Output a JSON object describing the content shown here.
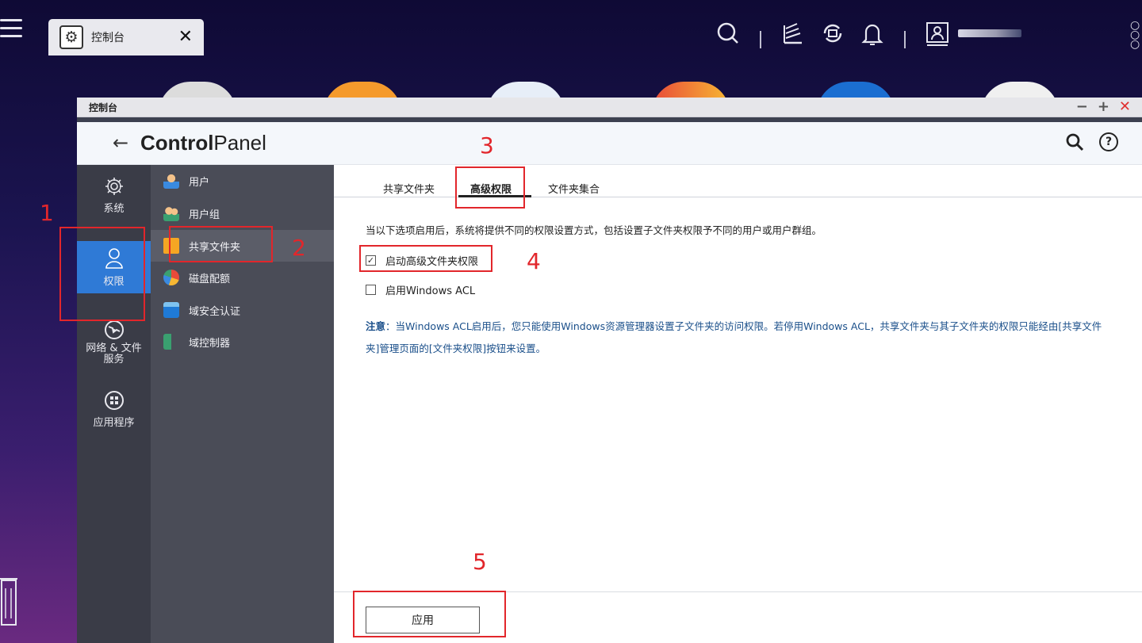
{
  "taskbar": {
    "tab_label": "控制台",
    "tab_close": "✕"
  },
  "window": {
    "title": "控制台",
    "controls": {
      "minimize": "−",
      "maximize": "+",
      "close": "✕"
    }
  },
  "app_header": {
    "back": "←",
    "title_bold": "Control",
    "title_light": "Panel",
    "help": "?"
  },
  "categories": [
    {
      "label": "系统",
      "icon": "gear-icon"
    },
    {
      "label": "权限",
      "icon": "user-icon",
      "active": true
    },
    {
      "label": "网络 & 文件服务",
      "icon": "globe-icon"
    },
    {
      "label": "应用程序",
      "icon": "apps-grid-icon"
    }
  ],
  "sub_items": [
    {
      "label": "用户",
      "icon": "user-icon"
    },
    {
      "label": "用户组",
      "icon": "user-group-icon"
    },
    {
      "label": "共享文件夹",
      "icon": "shared-folder-icon",
      "active": true
    },
    {
      "label": "磁盘配额",
      "icon": "disk-quota-icon"
    },
    {
      "label": "域安全认证",
      "icon": "domain-security-icon"
    },
    {
      "label": "域控制器",
      "icon": "domain-controller-icon"
    }
  ],
  "tabs": [
    {
      "label": "共享文件夹"
    },
    {
      "label": "高级权限",
      "active": true
    },
    {
      "label": "文件夹集合"
    }
  ],
  "content": {
    "description": "当以下选项启用后，系统将提供不同的权限设置方式，包括设置子文件夹权限予不同的用户或用户群组。",
    "option_advanced": {
      "label": "启动高级文件夹权限",
      "checked": true
    },
    "option_acl": {
      "label": "启用Windows ACL",
      "checked": false
    },
    "note_prefix": "注意",
    "note_text": "：当Windows ACL启用后，您只能使用Windows资源管理器设置子文件夹的访问权限。若停用Windows ACL，共享文件夹与其子文件夹的权限只能经由[共享文件夹]管理页面的[文件夹权限]按钮来设置。"
  },
  "footer": {
    "apply_label": "应用"
  },
  "annotations": [
    "1",
    "2",
    "3",
    "4",
    "5"
  ],
  "colors": {
    "accent": "#2f7ad6",
    "annotation_red": "#e2262b",
    "sidebar_dark": "#3a3c47",
    "sidebar_mid": "#4a4c57",
    "note_blue": "#1a4f8a"
  }
}
